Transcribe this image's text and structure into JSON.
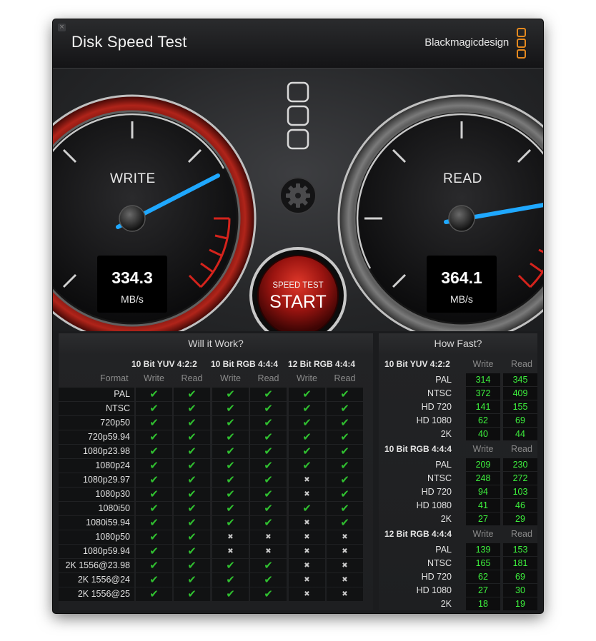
{
  "window": {
    "title": "Disk Speed Test",
    "brand": "Blackmagicdesign",
    "close_glyph": "×"
  },
  "gauges": {
    "write": {
      "label": "WRITE",
      "value": "334.3",
      "unit": "MB/s"
    },
    "read": {
      "label": "READ",
      "value": "364.1",
      "unit": "MB/s"
    }
  },
  "start_button": {
    "line1": "SPEED TEST",
    "line2": "START"
  },
  "icons": {
    "settings": "gear-icon",
    "logo": "blackmagic-logo-icon",
    "check": "check-icon",
    "cross": "cross-icon"
  },
  "will_it_work": {
    "title": "Will it Work?",
    "format_label": "Format",
    "groups": [
      "10 Bit YUV 4:2:2",
      "10 Bit RGB 4:4:4",
      "12 Bit RGB 4:4:4"
    ],
    "sub_headers": [
      "Write",
      "Read",
      "Write",
      "Read",
      "Write",
      "Read"
    ],
    "rows": [
      {
        "format": "PAL",
        "support": [
          true,
          true,
          true,
          true,
          true,
          true
        ]
      },
      {
        "format": "NTSC",
        "support": [
          true,
          true,
          true,
          true,
          true,
          true
        ]
      },
      {
        "format": "720p50",
        "support": [
          true,
          true,
          true,
          true,
          true,
          true
        ]
      },
      {
        "format": "720p59.94",
        "support": [
          true,
          true,
          true,
          true,
          true,
          true
        ]
      },
      {
        "format": "1080p23.98",
        "support": [
          true,
          true,
          true,
          true,
          true,
          true
        ]
      },
      {
        "format": "1080p24",
        "support": [
          true,
          true,
          true,
          true,
          true,
          true
        ]
      },
      {
        "format": "1080p29.97",
        "support": [
          true,
          true,
          true,
          true,
          false,
          true
        ]
      },
      {
        "format": "1080p30",
        "support": [
          true,
          true,
          true,
          true,
          false,
          true
        ]
      },
      {
        "format": "1080i50",
        "support": [
          true,
          true,
          true,
          true,
          true,
          true
        ]
      },
      {
        "format": "1080i59.94",
        "support": [
          true,
          true,
          true,
          true,
          false,
          true
        ]
      },
      {
        "format": "1080p50",
        "support": [
          true,
          true,
          false,
          false,
          false,
          false
        ]
      },
      {
        "format": "1080p59.94",
        "support": [
          true,
          true,
          false,
          false,
          false,
          false
        ]
      },
      {
        "format": "2K 1556@23.98",
        "support": [
          true,
          true,
          true,
          true,
          false,
          false
        ]
      },
      {
        "format": "2K 1556@24",
        "support": [
          true,
          true,
          true,
          true,
          false,
          false
        ]
      },
      {
        "format": "2K 1556@25",
        "support": [
          true,
          true,
          true,
          true,
          false,
          false
        ]
      }
    ]
  },
  "how_fast": {
    "title": "How Fast?",
    "sections": [
      {
        "name": "10 Bit YUV 4:2:2",
        "write_label": "Write",
        "read_label": "Read",
        "rows": [
          {
            "format": "PAL",
            "write": "314",
            "read": "345"
          },
          {
            "format": "NTSC",
            "write": "372",
            "read": "409"
          },
          {
            "format": "HD 720",
            "write": "141",
            "read": "155"
          },
          {
            "format": "HD 1080",
            "write": "62",
            "read": "69"
          },
          {
            "format": "2K",
            "write": "40",
            "read": "44"
          }
        ]
      },
      {
        "name": "10 Bit RGB 4:4:4",
        "write_label": "Write",
        "read_label": "Read",
        "rows": [
          {
            "format": "PAL",
            "write": "209",
            "read": "230"
          },
          {
            "format": "NTSC",
            "write": "248",
            "read": "272"
          },
          {
            "format": "HD 720",
            "write": "94",
            "read": "103"
          },
          {
            "format": "HD 1080",
            "write": "41",
            "read": "46"
          },
          {
            "format": "2K",
            "write": "27",
            "read": "29"
          }
        ]
      },
      {
        "name": "12 Bit RGB 4:4:4",
        "write_label": "Write",
        "read_label": "Read",
        "rows": [
          {
            "format": "PAL",
            "write": "139",
            "read": "153"
          },
          {
            "format": "NTSC",
            "write": "165",
            "read": "181"
          },
          {
            "format": "HD 720",
            "write": "62",
            "read": "69"
          },
          {
            "format": "HD 1080",
            "write": "27",
            "read": "30"
          },
          {
            "format": "2K",
            "write": "18",
            "read": "19"
          }
        ]
      }
    ]
  },
  "colors": {
    "accent_needle": "#1fa8ff",
    "value_green": "#3ef33e",
    "check_green": "#30c030",
    "redline": "#d4231c",
    "logo_orange": "#e68a1f"
  }
}
